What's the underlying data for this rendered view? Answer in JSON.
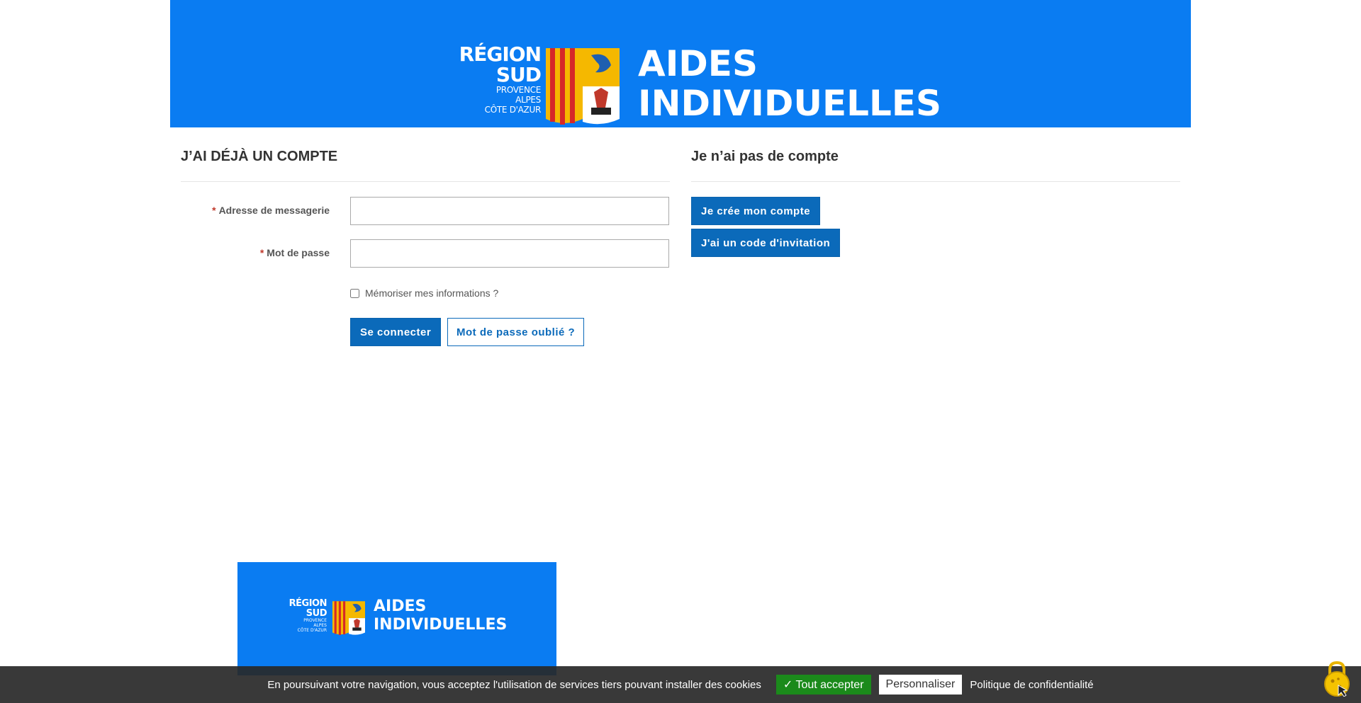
{
  "header": {
    "logo": {
      "line1": "RÉGION",
      "line2": "SUD",
      "line3": "PROVENCE",
      "line4": "ALPES",
      "line5": "CÔTE D'AZUR"
    },
    "title_line1": "AIDES",
    "title_line2": "INDIVIDUELLES"
  },
  "login": {
    "heading": "J’AI DÉJÀ UN COMPTE",
    "email_label": "Adresse de messagerie",
    "email_value": "",
    "password_label": "Mot de passe",
    "password_value": "",
    "required_mark": "*",
    "remember_label": "Mémoriser mes informations ?",
    "submit_label": "Se connecter",
    "forgot_label": "Mot de passe oublié ?"
  },
  "signup": {
    "heading": "Je n’ai pas de compte",
    "create_label": "Je crée mon compte",
    "invite_label": "J'ai un code d'invitation"
  },
  "cookies": {
    "text": "En poursuivant votre navigation, vous acceptez l'utilisation de services tiers pouvant installer des cookies",
    "accept_label": "Tout accepter",
    "accept_icon": "check-icon",
    "personalize_label": "Personnaliser",
    "privacy_label": "Politique de confidentialité",
    "floating_icon": "cookie-lock-icon"
  },
  "colors": {
    "banner_blue": "#0a7cf2",
    "primary_button": "#0b6aba",
    "accept_green": "#1b8a1b",
    "required_red": "#c0392b"
  }
}
